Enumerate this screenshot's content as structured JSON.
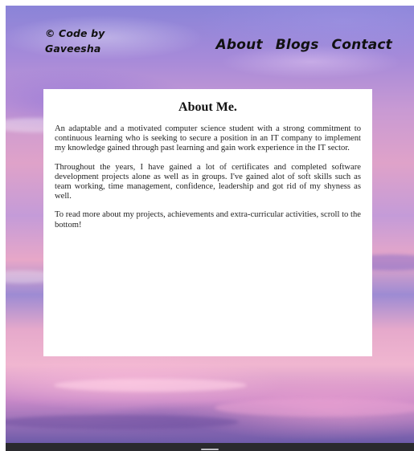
{
  "header": {
    "brand_line1": "© Code by",
    "brand_line2": "Gaveesha",
    "nav": [
      {
        "label": "About"
      },
      {
        "label": "Blogs"
      },
      {
        "label": "Contact"
      }
    ]
  },
  "about": {
    "title": "About Me.",
    "paragraphs": [
      "An adaptable and a motivated computer science student with a strong commitment to continuous learning who is seeking to secure a position in an IT company to implement my knowledge gained through past learning and gain work experience in the IT sector.",
      "Throughout the years, I have gained a lot of certificates and completed software development projects alone as well as in groups. I've gained alot of soft skills such as team working, time management, confidence, leadership and got rid of my shyness as well.",
      "To read more about my projects, achievements and extra-curricular activities, scroll to the bottom!"
    ]
  },
  "colors": {
    "sky_top": "#8a84d8",
    "sky_pink": "#e7a7c8",
    "sky_bottom": "#6c5aa8",
    "card_bg": "#ffffff",
    "text": "#111111"
  }
}
